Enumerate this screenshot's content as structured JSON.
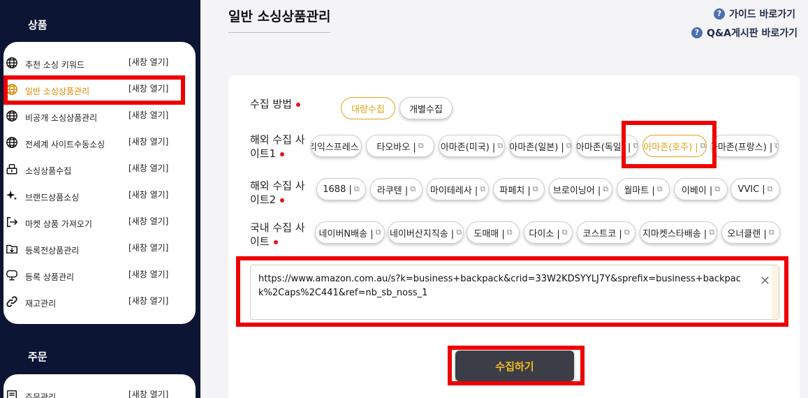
{
  "sidebar": {
    "section_product": "상품",
    "section_order": "주문",
    "open_label": "[새창 열기]",
    "product_items": [
      {
        "label": "추천 소싱 키워드",
        "icon": "globe-icon"
      },
      {
        "label": "일반 소싱상품관리",
        "icon": "globe-icon",
        "active": true
      },
      {
        "label": "비공개 소싱상품관리",
        "icon": "globe-icon"
      },
      {
        "label": "전세계 사이트수동소싱",
        "icon": "globe-icon"
      },
      {
        "label": "소싱상품수집",
        "icon": "collect-icon"
      },
      {
        "label": "브랜드상품소싱",
        "icon": "sparkle-icon"
      },
      {
        "label": "마켓 상품 가져오기",
        "icon": "import-icon"
      },
      {
        "label": "등록전상품관리",
        "icon": "folder-icon"
      },
      {
        "label": "등록 상품관리",
        "icon": "monitor-icon"
      },
      {
        "label": "재고관리",
        "icon": "link-icon"
      }
    ],
    "order_items": [
      {
        "label": "주문관리",
        "icon": "order-icon"
      }
    ],
    "active_color": "#d88a00"
  },
  "header": {
    "title": "일반 소싱상품관리",
    "guide_link": "가이드 바로가기",
    "qa_link": "Q&A게시판 바로가기"
  },
  "form": {
    "method_label": "수집 방법",
    "method_options": [
      "대량수집",
      "개별수집"
    ],
    "method_selected": "대량수집",
    "overseas1_label": "해외 수집 사이트1",
    "overseas1_sites": [
      "알리익스프레스 |",
      "타오바오 |",
      "아마존(미국) |",
      "아마존(일본) |",
      "아마존(독일) |",
      "아마존(호주) |",
      "아마존(프랑스) |"
    ],
    "overseas1_selected": "아마존(호주) |",
    "overseas2_label": "해외 수집 사이트2",
    "overseas2_sites": [
      "1688 |",
      "라쿠텐 |",
      "마이테레사 |",
      "파페치 |",
      "브로이닝어 |",
      "월마트 |",
      "이베이 |",
      "VVIC |"
    ],
    "domestic_label": "국내 수집 사이트",
    "domestic_sites": [
      "네이버N배송 |",
      "네이버산지직송 |",
      "도매매 |",
      "다이소 |",
      "코스트코 |",
      "지마켓스타배송 |",
      "오너클랜 |"
    ],
    "url_value": "https://www.amazon.com.au/s?k=business+backpack&crid=33W2KDSYYLJ7Y&sprefix=business+backpack%2Caps%2C441&ref=nb_sb_noss_1",
    "submit_label": "수집하기",
    "accent_color": "#e3a21a",
    "required_dot_color": "#e0151b"
  }
}
